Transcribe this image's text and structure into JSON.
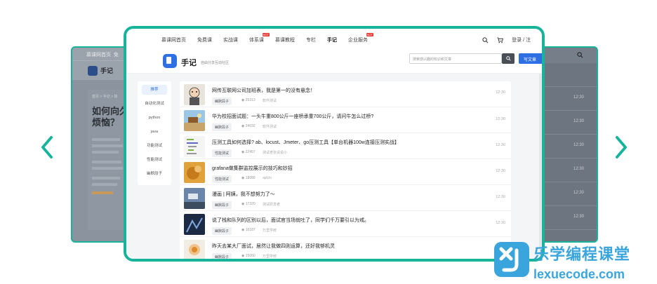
{
  "colors": {
    "accent": "#17b39b",
    "brand": "#2f6fe4",
    "watermark": "#3aa5dd"
  },
  "back_left": {
    "nav": "慕课网首页",
    "nav2": "免",
    "logo": "手记",
    "breadcrumb": "首页 > 手记 > 如",
    "heading1": "如何向久",
    "heading2": "烦恼？"
  },
  "nav": {
    "items": [
      {
        "label": "慕课网首页"
      },
      {
        "label": "免费课"
      },
      {
        "label": "实战课"
      },
      {
        "label": "体系课",
        "hot": "HOT"
      },
      {
        "label": "慕课教程"
      },
      {
        "label": "专栏"
      },
      {
        "label": "手记",
        "active": true
      },
      {
        "label": "企业服务",
        "hot": "HOT"
      }
    ],
    "login": "登录 / 注"
  },
  "header": {
    "title": "手记",
    "subtitle": "自由分享互动社区",
    "search_placeholder": "搜索感兴趣的知识和文章",
    "write_label": "写文章"
  },
  "sidebar": {
    "items": [
      {
        "label": "推荐",
        "active": true
      },
      {
        "label": "自动化测试"
      },
      {
        "label": "python"
      },
      {
        "label": "java"
      },
      {
        "label": "功能测试"
      },
      {
        "label": "性能测试"
      },
      {
        "label": "幽默段子"
      }
    ]
  },
  "articles": [
    {
      "title": "网传互联网公司加班表，我是第一的没有悬念！",
      "tag": "幽默段子",
      "views": "25313",
      "author": "软件测试",
      "time": "12:30",
      "time2": "12:30"
    },
    {
      "title": "华为校招面试题：一头牛重800公斤一座桥承重700公斤，请问牛怎么过桥?",
      "tag": "幽默段子",
      "views": "24032",
      "author": "软件测试",
      "time": "12:30",
      "time2": "12:30"
    },
    {
      "title": "压测工具如何选择? ab、locust、Jmeter、go压测工具【单台机器100w连接压测实战】",
      "tag": "性能测试",
      "views": "22457",
      "author": "测试老张说说小",
      "time": "12:30",
      "time2": "12:30"
    },
    {
      "title": "grafana做集群监控展示的技巧和妙招",
      "tag": "性能测试",
      "views": "18089",
      "author": "aplclo",
      "time": "12:30",
      "time2": "12:30"
    },
    {
      "title": "漫画 | 阿姨，我不想努力了～",
      "tag": "幽默段子",
      "views": "17320",
      "author": "测试研发者",
      "time": "12:30",
      "time2": "12:30"
    },
    {
      "title": "说了栈和队列的区别以后，面试官当场就吐了，同学们千万要引以为戒。",
      "tag": "幽默段子",
      "views": "16187",
      "author": "万里学统",
      "time": "12:30",
      "time2": "12:30"
    },
    {
      "title": "昨天去某大厂面试，居然让我做四则运算，还好我够机灵",
      "tag": "幽默段子",
      "views": "15060",
      "author": "万里学统",
      "time": "12:30",
      "time2": "12:30"
    }
  ],
  "back_right_times": [
    "12:30",
    "12:30",
    "12:30",
    "12:30",
    "12:30",
    "12:30"
  ],
  "watermark": {
    "cn": "乐学编程课堂",
    "en": "lexuecode.com"
  }
}
